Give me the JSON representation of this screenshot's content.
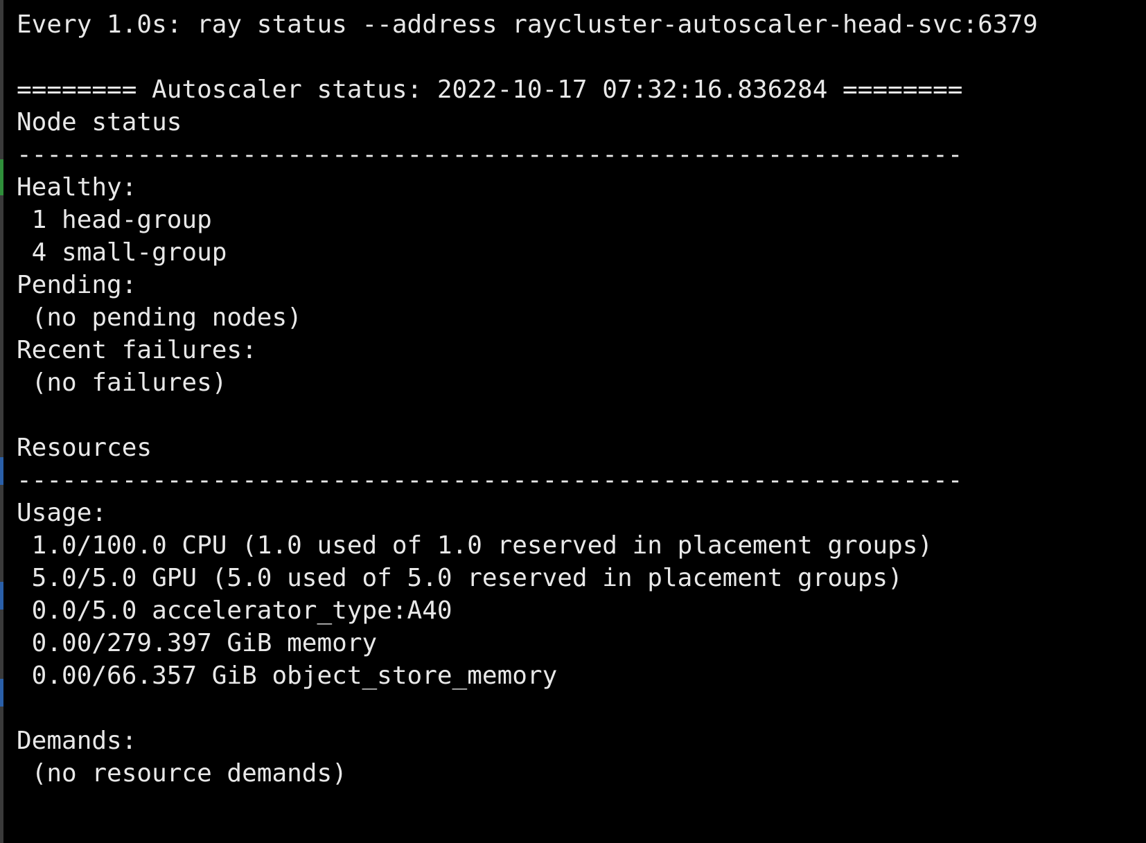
{
  "terminal": {
    "background": "#000000",
    "foreground": "#e8e8e8",
    "lines": [
      "Every 1.0s: ray status --address raycluster-autoscaler-head-svc:6379",
      "",
      "======== Autoscaler status: 2022-10-17 07:32:16.836284 ========",
      "Node status",
      "---------------------------------------------------------------",
      "Healthy:",
      " 1 head-group",
      " 4 small-group",
      "Pending:",
      " (no pending nodes)",
      "Recent failures:",
      " (no failures)",
      "",
      "Resources",
      "---------------------------------------------------------------",
      "Usage:",
      " 1.0/100.0 CPU (1.0 used of 1.0 reserved in placement groups)",
      " 5.0/5.0 GPU (5.0 used of 5.0 reserved in placement groups)",
      " 0.0/5.0 accelerator_type:A40",
      " 0.00/279.397 GiB memory",
      " 0.00/66.357 GiB object_store_memory",
      "",
      "Demands:",
      " (no resource demands)"
    ]
  }
}
